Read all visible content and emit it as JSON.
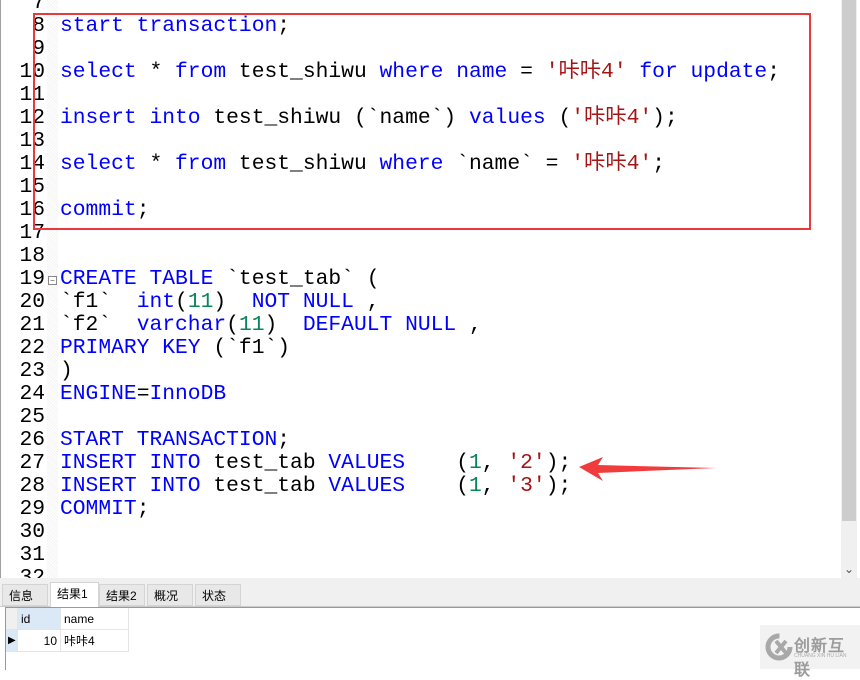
{
  "editor": {
    "first_line": 7,
    "lines": [
      [],
      [
        [
          "start transaction",
          "k"
        ],
        [
          ";",
          "p"
        ]
      ],
      [],
      [
        [
          "select",
          "k"
        ],
        [
          " * ",
          "p"
        ],
        [
          "from",
          "k"
        ],
        [
          " test_shiwu ",
          "p"
        ],
        [
          "where",
          "k"
        ],
        [
          " ",
          "p"
        ],
        [
          "name",
          "k"
        ],
        [
          " = ",
          "p"
        ],
        [
          "'咔咔4'",
          "s"
        ],
        [
          " ",
          "p"
        ],
        [
          "for",
          "k"
        ],
        [
          " ",
          "p"
        ],
        [
          "update",
          "k"
        ],
        [
          ";",
          "p"
        ]
      ],
      [],
      [
        [
          "insert",
          "k"
        ],
        [
          " ",
          "p"
        ],
        [
          "into",
          "k"
        ],
        [
          " test_shiwu (`name`) ",
          "p"
        ],
        [
          "values",
          "k"
        ],
        [
          " (",
          "p"
        ],
        [
          "'咔咔4'",
          "s"
        ],
        [
          ");",
          "p"
        ]
      ],
      [],
      [
        [
          "select",
          "k"
        ],
        [
          " * ",
          "p"
        ],
        [
          "from",
          "k"
        ],
        [
          " test_shiwu ",
          "p"
        ],
        [
          "where",
          "k"
        ],
        [
          " `name` = ",
          "p"
        ],
        [
          "'咔咔4'",
          "s"
        ],
        [
          ";",
          "p"
        ]
      ],
      [],
      [
        [
          "commit",
          "k"
        ],
        [
          ";",
          "p"
        ]
      ],
      [],
      [],
      [
        [
          "CREATE TABLE",
          "k"
        ],
        [
          " `test_tab` (",
          "p"
        ]
      ],
      [
        [
          "`f1`  ",
          "p"
        ],
        [
          "int",
          "k"
        ],
        [
          "(",
          "p"
        ],
        [
          "11",
          "n"
        ],
        [
          ")  ",
          "p"
        ],
        [
          "NOT NULL",
          "k"
        ],
        [
          " ,",
          "p"
        ]
      ],
      [
        [
          "`f2`  ",
          "p"
        ],
        [
          "varchar",
          "k"
        ],
        [
          "(",
          "p"
        ],
        [
          "11",
          "n"
        ],
        [
          ")  ",
          "p"
        ],
        [
          "DEFAULT NULL",
          "k"
        ],
        [
          " ,",
          "p"
        ]
      ],
      [
        [
          "PRIMARY KEY",
          "k"
        ],
        [
          " (`f1`)",
          "p"
        ]
      ],
      [
        [
          ")",
          "p"
        ]
      ],
      [
        [
          "ENGINE",
          "k"
        ],
        [
          "=",
          "p"
        ],
        [
          "InnoDB",
          "k"
        ]
      ],
      [],
      [
        [
          "START TRANSACTION",
          "k"
        ],
        [
          ";",
          "p"
        ]
      ],
      [
        [
          "INSERT INTO",
          "k"
        ],
        [
          " test_tab ",
          "p"
        ],
        [
          "VALUES",
          "k"
        ],
        [
          "    (",
          "p"
        ],
        [
          "1",
          "n"
        ],
        [
          ", ",
          "p"
        ],
        [
          "'2'",
          "s"
        ],
        [
          ");",
          "p"
        ]
      ],
      [
        [
          "INSERT INTO",
          "k"
        ],
        [
          " test_tab ",
          "p"
        ],
        [
          "VALUES",
          "k"
        ],
        [
          "    (",
          "p"
        ],
        [
          "1",
          "n"
        ],
        [
          ", ",
          "p"
        ],
        [
          "'3'",
          "s"
        ],
        [
          ");",
          "p"
        ]
      ],
      [
        [
          "COMMIT",
          "k"
        ],
        [
          ";",
          "p"
        ]
      ],
      [],
      [],
      []
    ],
    "fold_lines": [
      19
    ]
  },
  "tabs": [
    {
      "label": "信息",
      "active": false
    },
    {
      "label": "结果1",
      "active": true
    },
    {
      "label": "结果2",
      "active": false
    },
    {
      "label": "概况",
      "active": false
    },
    {
      "label": "状态",
      "active": false
    }
  ],
  "result": {
    "columns": [
      "id",
      "name"
    ],
    "rows": [
      [
        "10",
        "咔咔4"
      ]
    ]
  },
  "watermark": {
    "text": "创新互联",
    "sub": "CHUANG XIN HU LIAN"
  },
  "colors": {
    "keyword": "#0000ff",
    "string": "#a31515",
    "number": "#098658",
    "highlight_box": "#e8393c",
    "arrow": "#f03c3c"
  }
}
